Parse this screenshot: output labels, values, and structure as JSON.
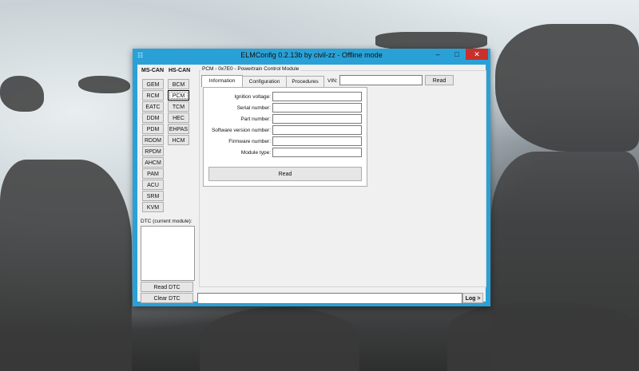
{
  "window": {
    "title": "ELMConfig 0.2.13b by civil-zz - Offline mode"
  },
  "window_controls": {
    "minimize": "–",
    "maximize": "□",
    "close": "✕"
  },
  "left_panel": {
    "ms_can_header": "MS-CAN",
    "hs_can_header": "HS-CAN",
    "ms_can_modules": [
      "GEM",
      "RCM",
      "EATC",
      "DDM",
      "PDM",
      "RDDM",
      "RPDM",
      "AHCM",
      "PAM",
      "ACU",
      "SRM",
      "KVM"
    ],
    "hs_can_modules": [
      "BCM",
      "PCM",
      "TCM",
      "HEC",
      "EHPAS",
      "HCM"
    ],
    "selected_module": "PCM",
    "dtc_label": "DTC (current module):",
    "read_dtc_label": "Read DTC",
    "clear_dtc_label": "Clear DTC"
  },
  "module_panel": {
    "title": "PCM - 0x7E0 - Powertrain Control Module",
    "tabs": [
      "Information",
      "Configuration",
      "Procedures"
    ],
    "active_tab": "Information",
    "vin_label": "VIN:",
    "vin_value": "",
    "vin_read_label": "Read",
    "fields": [
      {
        "label": "Ignition voltage:",
        "value": ""
      },
      {
        "label": "Serial number:",
        "value": ""
      },
      {
        "label": "Part number:",
        "value": ""
      },
      {
        "label": "Software version number:",
        "value": ""
      },
      {
        "label": "Firmware number:",
        "value": ""
      },
      {
        "label": "Module type:",
        "value": ""
      }
    ],
    "read_label": "Read"
  },
  "log": {
    "value": "",
    "button_label": "Log >"
  },
  "colors": {
    "window_border": "#2aa1d6",
    "close_button": "#c7302b",
    "annotation_arrow": "#e0115f"
  }
}
